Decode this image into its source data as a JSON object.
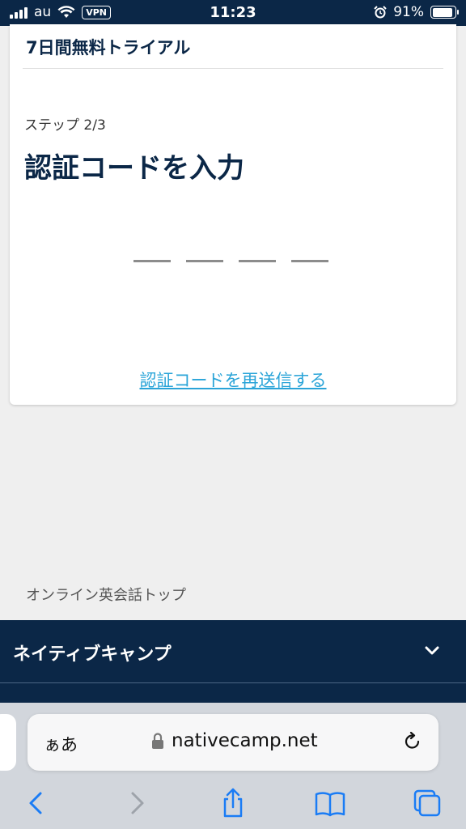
{
  "status_bar": {
    "carrier": "au",
    "vpn": "VPN",
    "time": "11:23",
    "battery": "91%",
    "battery_level": 0.91
  },
  "card": {
    "title": "7日間無料トライアル",
    "step": "ステップ 2/3",
    "heading": "認証コードを入力",
    "code_slots": 4,
    "resend_link": "認証コードを再送信する"
  },
  "footer": {
    "link": "オンライン英会話トップ",
    "nav_title": "ネイティブキャンプ",
    "nav_icon": "chevron-down-icon"
  },
  "safari": {
    "text_size_label": "ぁあ",
    "url": "nativecamp.net",
    "icons": [
      "lock-icon",
      "reload-icon",
      "back-icon",
      "forward-icon",
      "share-icon",
      "bookmarks-icon",
      "tabs-icon"
    ]
  },
  "colors": {
    "navy": "#0b2747",
    "link": "#2aa4d8",
    "ios_blue": "#1a7cf5"
  }
}
